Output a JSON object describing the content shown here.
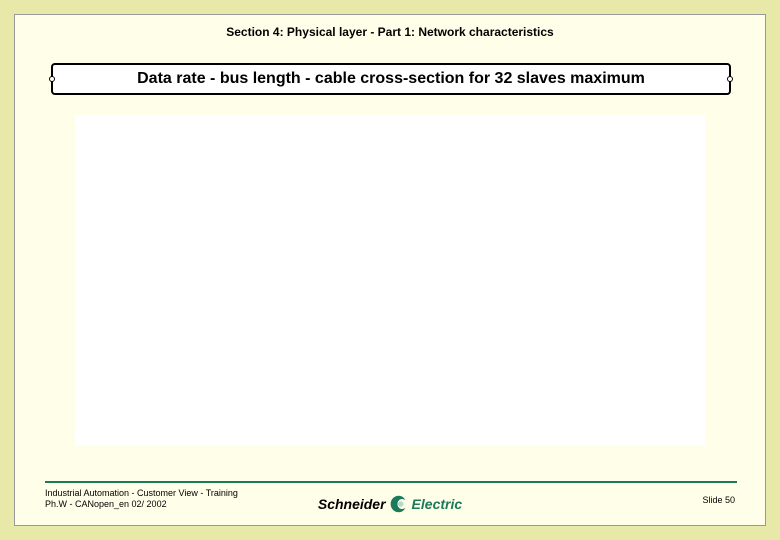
{
  "header": {
    "section_text": "Section 4: Physical layer - Part 1: Network characteristics"
  },
  "title": {
    "text": "Data rate - bus length - cable cross-section for 32 slaves maximum"
  },
  "footer": {
    "line1": "Industrial Automation -  Customer View -  Training",
    "line2": "Ph.W -  CANopen_en   02/ 2002",
    "slide_number": "Slide 50",
    "logo_part1": "Schneider",
    "logo_part2": "Electric"
  }
}
